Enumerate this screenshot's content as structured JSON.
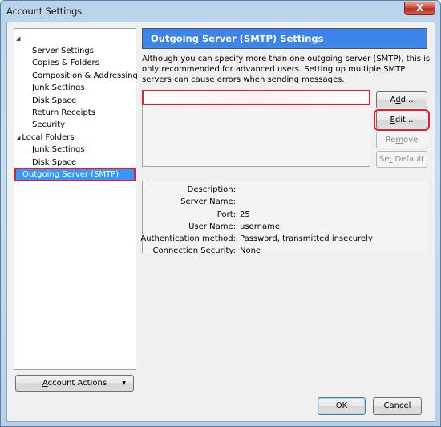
{
  "window": {
    "title": "Account Settings",
    "close_label": "X"
  },
  "tree": {
    "items": [
      {
        "label": "",
        "level": 0,
        "expanded": true
      },
      {
        "label": "Server Settings",
        "level": 1
      },
      {
        "label": "Copies & Folders",
        "level": 1
      },
      {
        "label": "Composition & Addressing",
        "level": 1
      },
      {
        "label": "Junk Settings",
        "level": 1
      },
      {
        "label": "Disk Space",
        "level": 1
      },
      {
        "label": "Return Receipts",
        "level": 1
      },
      {
        "label": "Security",
        "level": 1
      },
      {
        "label": "Local Folders",
        "level": 0,
        "expanded": true
      },
      {
        "label": "Junk Settings",
        "level": 1
      },
      {
        "label": "Disk Space",
        "level": 1
      },
      {
        "label": "Outgoing Server (SMTP)",
        "level": 0,
        "selected": true
      }
    ],
    "expand_glyph": "◢"
  },
  "account_actions": {
    "label_prefix": "",
    "mnemonic": "A",
    "label_rest": "ccount Actions",
    "arrow": "▼"
  },
  "panel": {
    "title": "Outgoing Server (SMTP) Settings",
    "description": "Although you can specify more than one outgoing server (SMTP), this is only recommended for advanced users. Setting up multiple SMTP servers can cause errors when sending messages."
  },
  "buttons": {
    "add": {
      "pre": "A",
      "mn": "d",
      "post": "d..."
    },
    "edit": {
      "pre": "",
      "mn": "E",
      "post": "dit..."
    },
    "remove": {
      "pre": "Re",
      "mn": "m",
      "post": "ove"
    },
    "set_default": {
      "pre": "Se",
      "mn": "t",
      "post": " Default"
    },
    "ok": "OK",
    "cancel": "Cancel"
  },
  "details": [
    {
      "label": "Description:",
      "value": ""
    },
    {
      "label": "Server Name:",
      "value": ""
    },
    {
      "label": "Port:",
      "value": "25"
    },
    {
      "label": "User Name:",
      "value": "username"
    },
    {
      "label": "Authentication method:",
      "value": "Password, transmitted insecurely"
    },
    {
      "label": "Connection Security:",
      "value": "None"
    }
  ],
  "colors": {
    "header_blue": "#3b86e8",
    "selection_blue": "#3399ff",
    "highlight_red": "#e0202a"
  }
}
